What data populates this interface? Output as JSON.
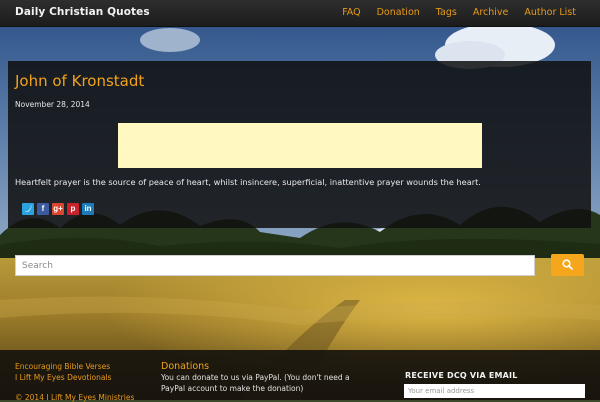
{
  "header": {
    "site_title": "Daily Christian Quotes",
    "nav": [
      "FAQ",
      "Donation",
      "Tags",
      "Archive",
      "Author List"
    ]
  },
  "post": {
    "title": "John of Kronstadt",
    "date": "November 28, 2014",
    "quote": "Heartfelt prayer is the source of peace of heart, whilst insincere, superficial, inattentive prayer wounds the heart.",
    "share_icons": [
      "twitter-icon",
      "facebook-icon",
      "google-plus-icon",
      "pinterest-icon",
      "linkedin-icon"
    ]
  },
  "search": {
    "placeholder": "Search",
    "button_icon": "search-icon"
  },
  "footer": {
    "links": [
      "Encouraging Bible Verses",
      "I Lift My Eyes Devotionals"
    ],
    "copyright": "© 2014 I Lift My Eyes Ministries",
    "donations_title": "Donations",
    "donations_text": "You can donate to us via PayPal. (You don't need a PayPal account to make the donation)",
    "email_title": "RECEIVE DCQ VIA EMAIL",
    "email_placeholder": "Your email address"
  },
  "colors": {
    "accent": "#f2a31c",
    "ad_box": "#fff8c0",
    "topbar": "#222222"
  }
}
